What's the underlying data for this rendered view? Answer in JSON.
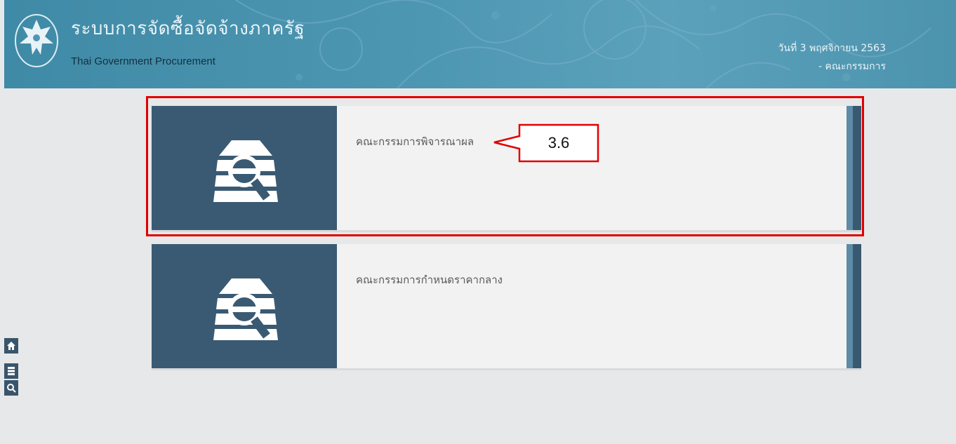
{
  "header": {
    "title_th": "ระบบการจัดซื้อจัดจ้างภาครัฐ",
    "title_en": "Thai Government Procurement",
    "date": "วันที่ 3 พฤศจิกายน 2563",
    "role": "- คณะกรรมการ"
  },
  "cards": [
    {
      "label": "คณะกรรมการพิจารณาผล",
      "icon": "committee-document-search-icon"
    },
    {
      "label": "คณะกรรมการกำหนดราคากลาง",
      "icon": "committee-document-search-icon"
    }
  ],
  "annotation": {
    "callout_label": "3.6",
    "color": "#e00000"
  },
  "sidebar": {
    "buttons": [
      "home-icon",
      "menu-icon",
      "search-icon"
    ]
  },
  "colors": {
    "header": "#4e97b3",
    "icon_panel": "#3a5a73",
    "background": "#e7e8e9"
  }
}
